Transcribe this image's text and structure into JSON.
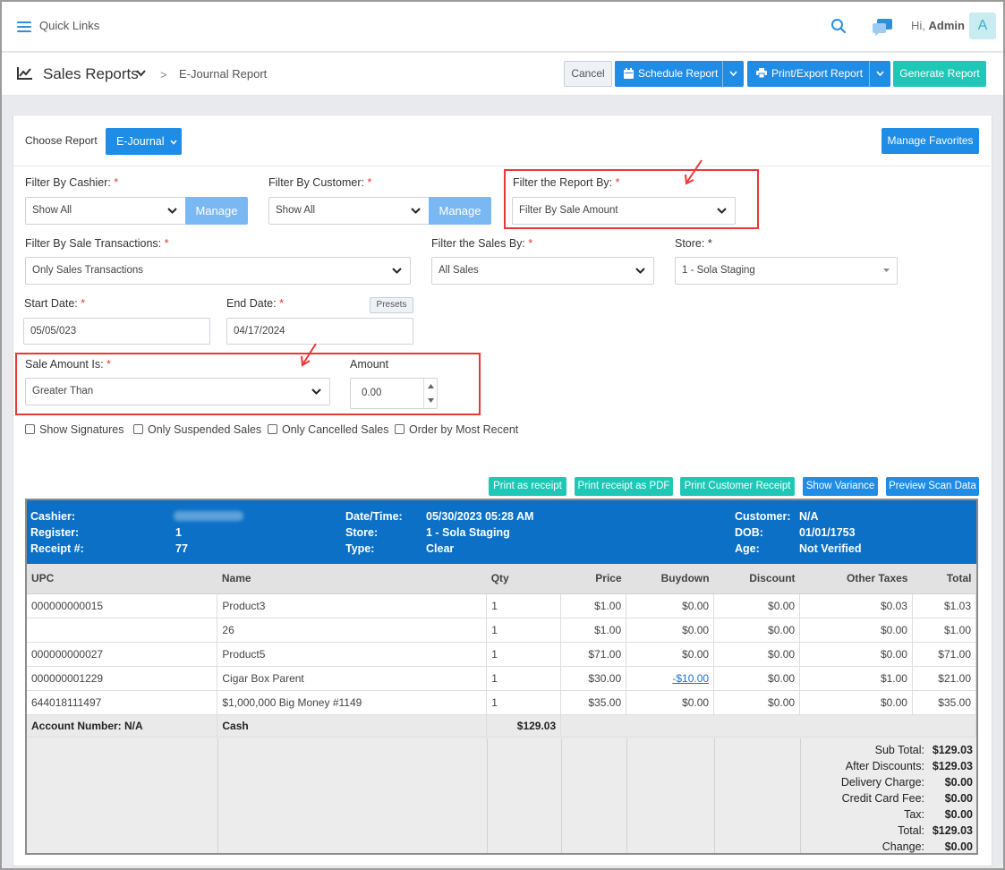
{
  "topbar": {
    "quick_links": "Quick Links",
    "greeting_prefix": "Hi,",
    "user_name": "Admin",
    "avatar_letter": "A",
    "icons": [
      "menu-icon",
      "search-icon",
      "chat-icon"
    ]
  },
  "header": {
    "title": "Sales Reports",
    "breadcrumb_separator": ">",
    "breadcrumb_current": "E-Journal Report",
    "cancel_label": "Cancel",
    "schedule_label": "Schedule Report",
    "print_label": "Print/Export Report",
    "generate_label": "Generate Report"
  },
  "report": {
    "choose_label": "Choose Report",
    "selected": "E-Journal",
    "manage_favorites": "Manage Favorites"
  },
  "filters": {
    "cashier_label": "Filter By Cashier:",
    "cashier_value": "Show All",
    "manage_label": "Manage",
    "customer_label": "Filter By Customer:",
    "customer_value": "Show All",
    "report_by_label": "Filter the Report By:",
    "report_by_value": "Filter By Sale Amount",
    "transactions_label": "Filter By Sale Transactions:",
    "transactions_value": "Only Sales Transactions",
    "sales_by_label": "Filter the Sales By:",
    "sales_by_value": "All Sales",
    "store_label": "Store: *",
    "store_value": "1 - Sola Staging",
    "start_label": "Start Date:",
    "start_value": "05/05/023",
    "end_label": "End Date:",
    "end_value": "04/17/2024",
    "presets_label": "Presets",
    "sale_amount_label": "Sale Amount Is:",
    "sale_amount_value": "Greater Than",
    "amount_label": "Amount",
    "amount_value": "0.00",
    "required_mark": "*"
  },
  "checkboxes": [
    "Show Signatures",
    "Only Suspended Sales",
    "Only Cancelled Sales",
    "Order by Most Recent"
  ],
  "actions": [
    "Print as receipt",
    "Print receipt as PDF",
    "Print Customer Receipt",
    "Show Variance",
    "Preview Scan Data"
  ],
  "receipt": {
    "labels": {
      "cashier": "Cashier:",
      "register": "Register:",
      "receipt": "Receipt #:",
      "datetime": "Date/Time:",
      "store": "Store:",
      "type": "Type:",
      "customer": "Customer:",
      "dob": "DOB:",
      "age": "Age:"
    },
    "values": {
      "register": "1",
      "receipt": "77",
      "datetime": "05/30/2023 05:28 AM",
      "store": "1 - Sola Staging",
      "type": "Clear",
      "customer": "N/A",
      "dob": "01/01/1753",
      "age": "Not Verified"
    },
    "columns": [
      "UPC",
      "Name",
      "Qty",
      "Price",
      "Buydown",
      "Discount",
      "Other Taxes",
      "Total"
    ],
    "rows": [
      [
        "000000000015",
        "Product3",
        "1",
        "$1.00",
        "$0.00",
        "$0.00",
        "$0.03",
        "$1.03"
      ],
      [
        "",
        "26",
        "1",
        "$1.00",
        "$0.00",
        "$0.00",
        "$0.00",
        "$1.00"
      ],
      [
        "000000000027",
        "Product5",
        "1",
        "$71.00",
        "$0.00",
        "$0.00",
        "$0.00",
        "$71.00"
      ],
      [
        "000000001229",
        "Cigar Box Parent",
        "1",
        "$30.00",
        "-$10.00",
        "$0.00",
        "$1.00",
        "$21.00"
      ],
      [
        "644018111497",
        "$1,000,000 Big Money #1149",
        "1",
        "$35.00",
        "$0.00",
        "$0.00",
        "$0.00",
        "$35.00"
      ]
    ],
    "account": {
      "label": "Account Number: N/A",
      "method": "Cash",
      "amount": "$129.03"
    },
    "totals": [
      {
        "label": "Sub Total:",
        "value": "$129.03"
      },
      {
        "label": "After Discounts:",
        "value": "$129.03"
      },
      {
        "label": "Delivery Charge:",
        "value": "$0.00"
      },
      {
        "label": "Credit Card Fee:",
        "value": "$0.00"
      },
      {
        "label": "Tax:",
        "value": "$0.00"
      },
      {
        "label": "Total:",
        "value": "$129.03"
      },
      {
        "label": "Change:",
        "value": "$0.00"
      }
    ]
  },
  "colors": {
    "primary": "#1f8ce6",
    "teal": "#1fc7b6",
    "header_blue": "#0b70c6",
    "highlight": "#e53935"
  }
}
